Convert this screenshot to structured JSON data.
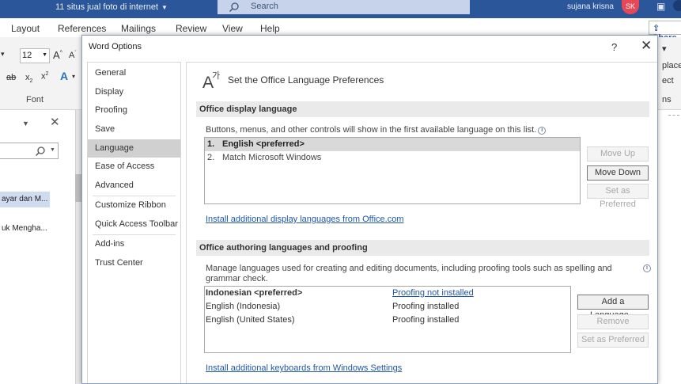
{
  "titlebar": {
    "doc_title": "11 situs jual foto di internet",
    "search_placeholder": "Search",
    "user_name": "sujana krisna",
    "user_initials": "SK"
  },
  "ribbon": {
    "tabs": [
      "Layout",
      "References",
      "Mailings",
      "Review",
      "View",
      "Help"
    ],
    "share_label": "Share",
    "font_size": "12",
    "font_group_label": "Font",
    "right_items": [
      "place",
      "ect",
      "ns"
    ]
  },
  "nav_pane": {
    "item1": "ayar dan M...",
    "item2": "uk Mengha..."
  },
  "dialog": {
    "title": "Word Options",
    "help_label": "?",
    "close_label": "✕",
    "nav": [
      {
        "label": "General"
      },
      {
        "label": "Display"
      },
      {
        "label": "Proofing"
      },
      {
        "label": "Save"
      },
      {
        "label": "Language",
        "selected": true
      },
      {
        "label": "Ease of Access"
      },
      {
        "label": "Advanced"
      },
      {
        "label": "Customize Ribbon"
      },
      {
        "label": "Quick Access Toolbar"
      },
      {
        "label": "Add-ins"
      },
      {
        "label": "Trust Center"
      }
    ],
    "page_title": "Set the Office Language Preferences",
    "display_section": {
      "header": "Office display language",
      "description": "Buttons, menus, and other controls will show in the first available language on this list.",
      "languages": [
        {
          "num": "1.",
          "name": "English <preferred>",
          "selected": true
        },
        {
          "num": "2.",
          "name": "Match Microsoft Windows",
          "selected": false
        }
      ],
      "move_up": "Move Up",
      "move_down": "Move Down",
      "set_preferred": "Set as Preferred",
      "install_link": "Install additional display languages from Office.com"
    },
    "authoring_section": {
      "header": "Office authoring languages and proofing",
      "description": "Manage languages used for creating and editing documents, including proofing tools such as spelling and grammar check.",
      "languages": [
        {
          "name": "Indonesian <preferred>",
          "proofing": "Proofing not installed",
          "preferred": true
        },
        {
          "name": "English (Indonesia)",
          "proofing": "Proofing installed",
          "preferred": false
        },
        {
          "name": "English (United States)",
          "proofing": "Proofing installed",
          "preferred": false
        }
      ],
      "add_language": "Add a Language...",
      "remove": "Remove",
      "set_preferred": "Set as Preferred",
      "install_link": "Install additional keyboards from Windows Settings"
    }
  }
}
